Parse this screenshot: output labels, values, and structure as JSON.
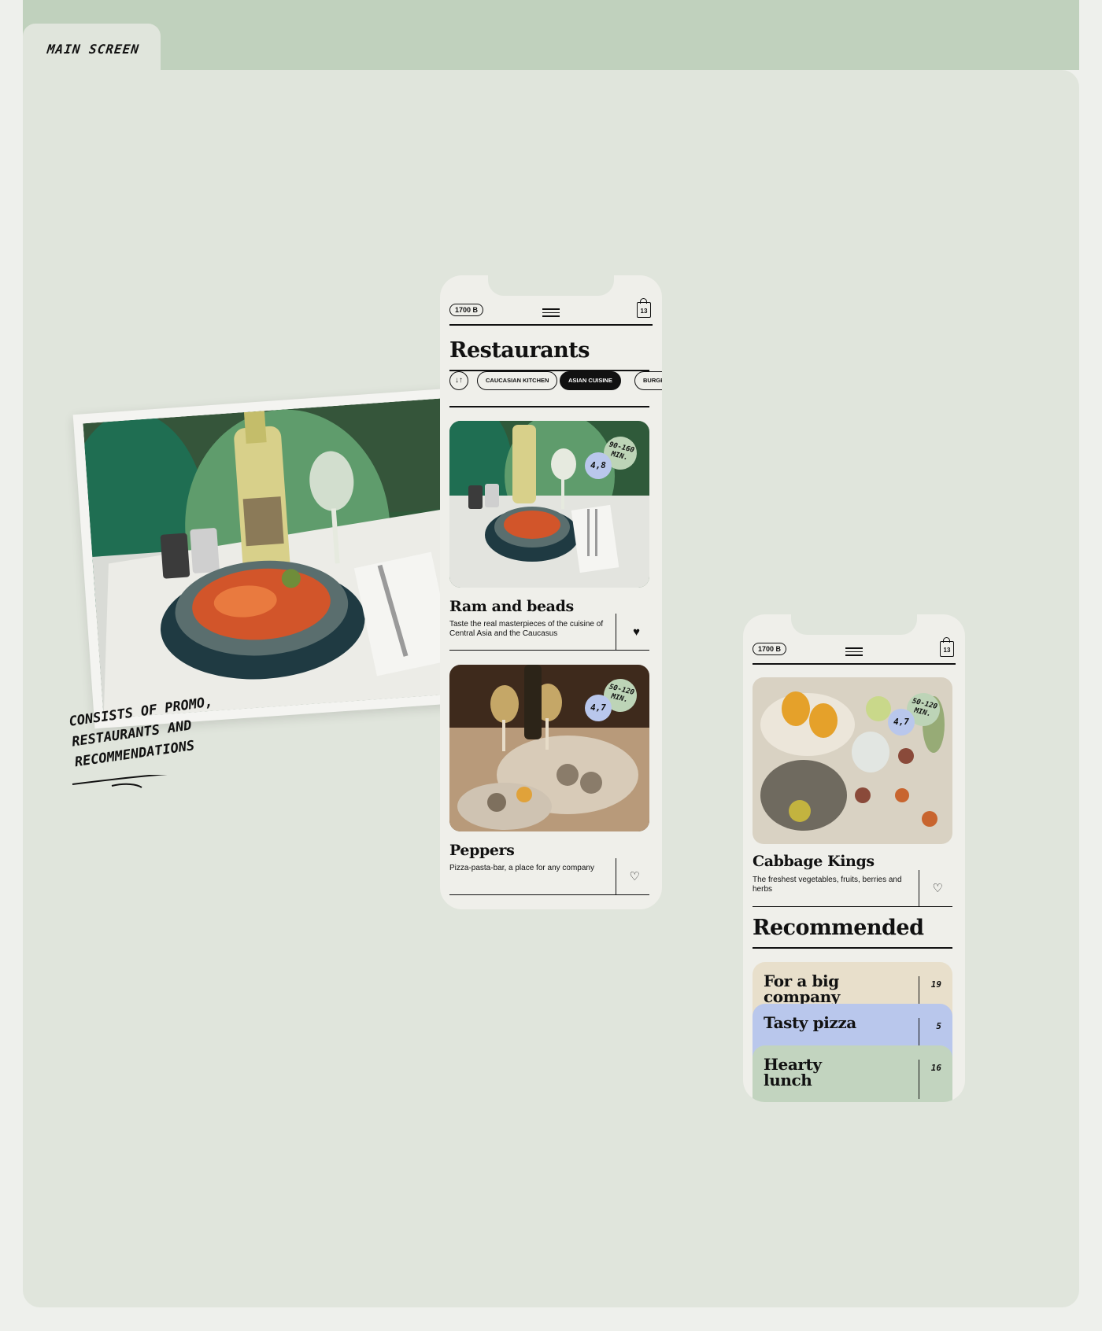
{
  "section": {
    "tab_label": "MAIN SCREEN"
  },
  "annotation": {
    "lines": [
      "CONSISTS OF PROMO,",
      "RESTAURANTS AND",
      "RECOMMENDATIONS"
    ]
  },
  "phone1": {
    "balance": "1700 B",
    "cart_count": "13",
    "title": "Restaurants",
    "sort_icon": "↓↑",
    "chips": [
      "CAUCASIAN KITCHEN",
      "ASIAN CUISINE",
      "BURGERS"
    ],
    "active_chip": "ASIAN CUISINE",
    "cards": [
      {
        "name": "Ram and beads",
        "desc": "Taste the real masterpieces of the cuisine of Central Asia and the Caucasus",
        "rating": "4,8",
        "time": "90-160 MIN.",
        "favorite": true
      },
      {
        "name": "Peppers",
        "desc": "Pizza-pasta-bar, a place for any company",
        "rating": "4,7",
        "time": "50-120 MIN.",
        "favorite": false
      }
    ]
  },
  "phone2": {
    "balance": "1700 B",
    "cart_count": "13",
    "card": {
      "name": "Cabbage Kings",
      "desc": "The freshest vegetables, fruits, berries and herbs",
      "rating": "4,7",
      "time": "50-120 MIN.",
      "favorite": false
    },
    "rec_title": "Recommended",
    "recommendations": [
      {
        "title": "For a big company",
        "count": "19",
        "color": "#e8dfcb"
      },
      {
        "title": "Tasty pizza",
        "count": "5",
        "color": "#b9c7ec"
      },
      {
        "title": "Hearty lunch",
        "count": "16",
        "color": "#c2d4bf"
      }
    ]
  },
  "colors": {
    "background": "#e0e5dc",
    "band": "#c0d1bd",
    "phone": "#efefea",
    "rating_badge": "#b9c7ec",
    "time_badge": "#bdd4b7"
  }
}
